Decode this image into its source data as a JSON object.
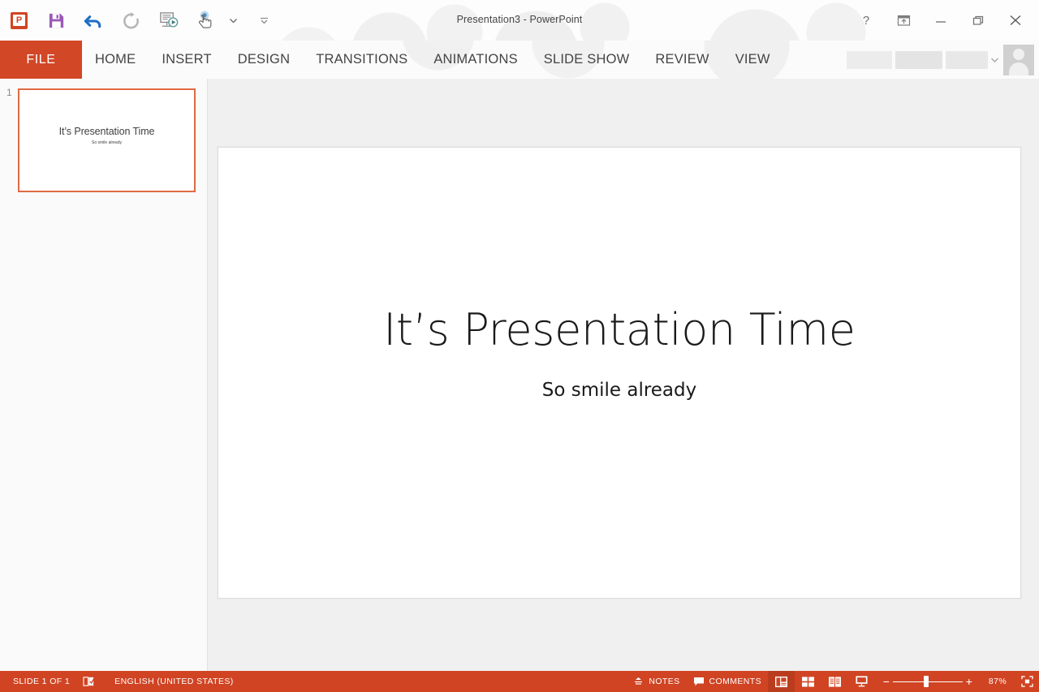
{
  "window": {
    "title": "Presentation3 - PowerPoint",
    "app_icon": "powerpoint-logo-icon",
    "logo_letter": "P"
  },
  "quick_access": {
    "items": [
      {
        "name": "save-icon",
        "label": "Save"
      },
      {
        "name": "undo-icon",
        "label": "Undo"
      },
      {
        "name": "redo-icon",
        "label": "Redo"
      },
      {
        "name": "start-from-beginning-icon",
        "label": "Start From Beginning"
      },
      {
        "name": "touch-mouse-mode-icon",
        "label": "Touch/Mouse Mode"
      },
      {
        "name": "customize-quick-access-toolbar-icon",
        "label": "Customize Quick Access Toolbar"
      }
    ]
  },
  "window_controls": {
    "help": "?",
    "ribbon_display_options": "Ribbon Display Options",
    "minimize": "Minimize",
    "restore": "Restore Down",
    "close": "Close"
  },
  "ribbon": {
    "tabs": [
      {
        "label": "FILE",
        "active": true
      },
      {
        "label": "HOME",
        "active": false
      },
      {
        "label": "INSERT",
        "active": false
      },
      {
        "label": "DESIGN",
        "active": false
      },
      {
        "label": "TRANSITIONS",
        "active": false
      },
      {
        "label": "ANIMATIONS",
        "active": false
      },
      {
        "label": "SLIDE SHOW",
        "active": false
      },
      {
        "label": "REVIEW",
        "active": false
      },
      {
        "label": "VIEW",
        "active": false
      }
    ],
    "account": {
      "name_redacted": true,
      "avatar": "user-avatar-icon"
    }
  },
  "thumbnails": {
    "slides": [
      {
        "number": "1",
        "title": "It’s Presentation Time",
        "subtitle": "So smile already",
        "selected": true
      }
    ]
  },
  "slide": {
    "title": "It’s Presentation Time",
    "subtitle": "So smile already"
  },
  "status_bar": {
    "slide_counter": "SLIDE 1 OF 1",
    "spellcheck_icon": "spellcheck-icon",
    "language": "ENGLISH (UNITED STATES)",
    "notes_label": "NOTES",
    "comments_label": "COMMENTS",
    "views": [
      {
        "name": "normal-view",
        "label": "Normal",
        "active": true
      },
      {
        "name": "slide-sorter-view",
        "label": "Slide Sorter",
        "active": false
      },
      {
        "name": "reading-view",
        "label": "Reading View",
        "active": false
      },
      {
        "name": "slide-show-view",
        "label": "Slide Show",
        "active": false
      }
    ],
    "zoom": {
      "minus": "−",
      "plus": "+",
      "percent": "87%",
      "fit_icon": "fit-slide-to-window-icon"
    }
  },
  "colors": {
    "accent": "#d04423",
    "file_tab": "#d24726",
    "thumb_border": "#e06a43",
    "workspace": "#f0f0f0"
  }
}
